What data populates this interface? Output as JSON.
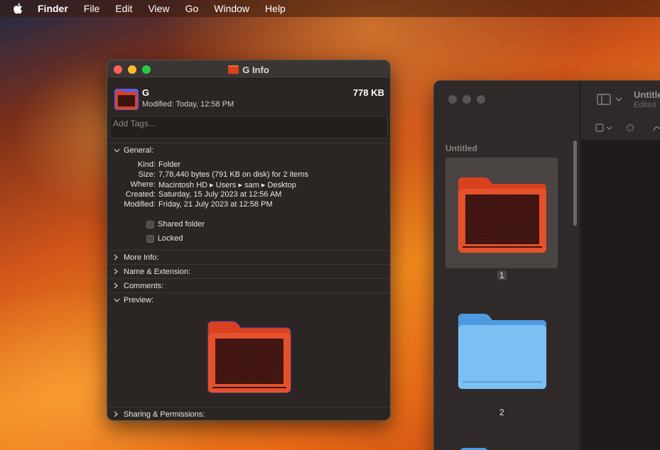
{
  "menubar": {
    "app_name": "Finder",
    "items": [
      "File",
      "Edit",
      "View",
      "Go",
      "Window",
      "Help"
    ]
  },
  "info_window": {
    "title": "G Info",
    "name": "G",
    "size": "778 KB",
    "modified_line": "Modified: Today, 12:58 PM",
    "tags_placeholder": "Add Tags...",
    "sections": {
      "general": "General:",
      "more_info": "More Info:",
      "name_extension": "Name & Extension:",
      "comments": "Comments:",
      "preview": "Preview:",
      "sharing": "Sharing & Permissions:"
    },
    "general": {
      "kind_label": "Kind:",
      "kind": "Folder",
      "size_label": "Size:",
      "size": "7,78,440 bytes (791 KB on disk) for 2 items",
      "where_label": "Where:",
      "where": "Macintosh HD ▸ Users ▸ sam ▸ Desktop",
      "created_label": "Created:",
      "created": "Saturday, 15 July 2023 at 12:56 AM",
      "modified_label": "Modified:",
      "modified": "Friday, 21 July 2023 at 12:58 PM",
      "shared_folder": "Shared folder",
      "locked": "Locked"
    }
  },
  "finder": {
    "sidebar_heading": "Untitled",
    "title": "Untitled",
    "subtitle": "Edited",
    "pages": [
      "1",
      "2"
    ]
  },
  "colors": {
    "accent_folder": "#d9411e",
    "blue_folder": "#6fb5f0"
  }
}
